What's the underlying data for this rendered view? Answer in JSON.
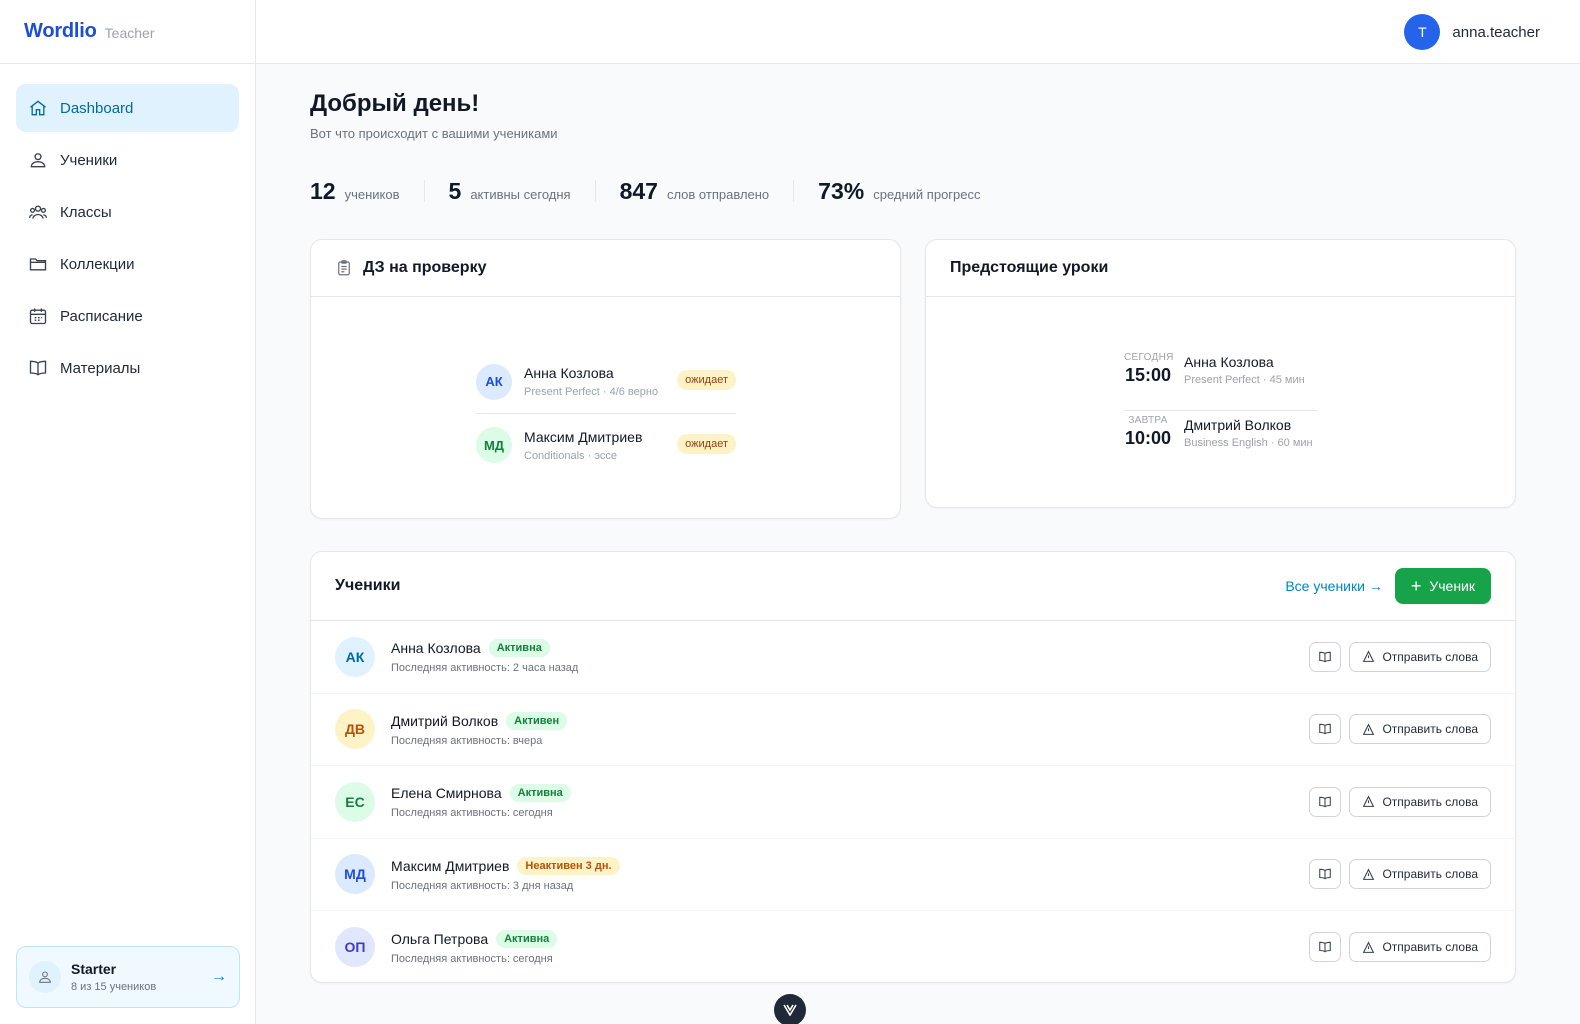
{
  "brand": {
    "name": "Wordlio",
    "role": "Teacher"
  },
  "sidebar": {
    "items": [
      {
        "label": "Dashboard",
        "icon": "home-icon",
        "active": true
      },
      {
        "label": "Ученики",
        "icon": "user-icon"
      },
      {
        "label": "Классы",
        "icon": "users-icon"
      },
      {
        "label": "Коллекции",
        "icon": "folder-icon"
      },
      {
        "label": "Расписание",
        "icon": "calendar-icon"
      },
      {
        "label": "Материалы",
        "icon": "book-icon"
      }
    ],
    "plan": {
      "title": "Starter",
      "subtitle": "8 из 15 учеников"
    }
  },
  "user": {
    "initial": "T",
    "name": "anna.teacher"
  },
  "greeting": {
    "title": "Добрый день!",
    "subtitle": "Вот что происходит с вашими учениками"
  },
  "stats": [
    {
      "value": "12",
      "label": "учеников"
    },
    {
      "value": "5",
      "label": "активны сегодня"
    },
    {
      "value": "847",
      "label": "слов отправлено"
    },
    {
      "value": "73%",
      "label": "средний прогресс"
    }
  ],
  "homework": {
    "title": "ДЗ на проверку",
    "items": [
      {
        "initials": "АК",
        "name": "Анна Козлова",
        "meta": "Present Perfect · 4/6 верно",
        "status": "ожидает"
      },
      {
        "initials": "МД",
        "name": "Максим Дмитриев",
        "meta": "Conditionals · эссе",
        "status": "ожидает"
      }
    ]
  },
  "lessons": {
    "title": "Предстоящие уроки",
    "items": [
      {
        "day": "СЕГОДНЯ",
        "time": "15:00",
        "name": "Анна Козлова",
        "meta": "Present Perfect · 45 мин"
      },
      {
        "day": "ЗАВТРА",
        "time": "10:00",
        "name": "Дмитрий Волков",
        "meta": "Business English · 60 мин"
      }
    ]
  },
  "students": {
    "title": "Ученики",
    "all_link": "Все ученики →",
    "add_label": "Ученик",
    "send_label": "Отправить слова",
    "rows": [
      {
        "initials": "АК",
        "name": "Анна Козлова",
        "status": "Активна",
        "status_type": "ok",
        "activity": "Последняя активность: 2 часа назад"
      },
      {
        "initials": "ДВ",
        "name": "Дмитрий Волков",
        "status": "Активен",
        "status_type": "ok",
        "activity": "Последняя активность: вчера"
      },
      {
        "initials": "ЕС",
        "name": "Елена Смирнова",
        "status": "Активна",
        "status_type": "ok",
        "activity": "Последняя активность: сегодня"
      },
      {
        "initials": "МД",
        "name": "Максим Дмитриев",
        "status": "Неактивен 3 дн.",
        "status_type": "warn",
        "activity": "Последняя активность: 3 дня назад"
      },
      {
        "initials": "ОП",
        "name": "Ольга Петрова",
        "status": "Активна",
        "status_type": "ok",
        "activity": "Последняя активность: сегодня"
      }
    ]
  },
  "colors": {
    "accent": "#1d4ed8",
    "active_nav": "#e0f2fe",
    "success": "#16a34a",
    "warning": "#fef3c7"
  }
}
